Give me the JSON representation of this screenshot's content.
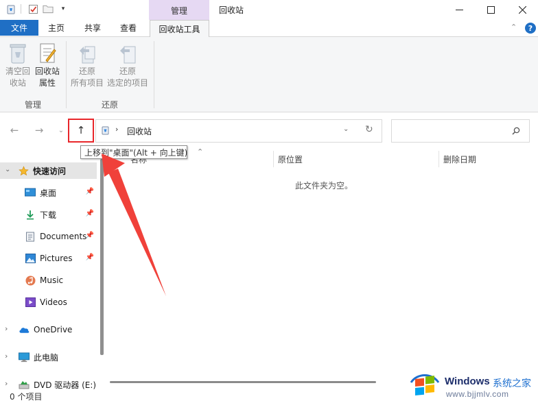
{
  "titlebar": {
    "context_tab": "管理",
    "window_title": "回收站",
    "quick_access_icons": [
      "recycle-bin-icon",
      "properties-check-icon",
      "folder-icon",
      "dropdown-arrow-icon"
    ],
    "window_controls": [
      "minimize-icon",
      "maximize-icon",
      "close-icon"
    ]
  },
  "ribbon_tabs": {
    "file": "文件",
    "home": "主页",
    "share": "共享",
    "view": "查看",
    "recycle_tools": "回收站工具"
  },
  "ribbon": {
    "groups": {
      "manage": "管理",
      "restore": "还原"
    },
    "buttons": {
      "empty_line1": "清空回",
      "empty_line2": "收站",
      "props_line1": "回收站",
      "props_line2": "属性",
      "restore_all_line1": "还原",
      "restore_all_line2": "所有项目",
      "restore_sel_line1": "还原",
      "restore_sel_line2": "选定的项目"
    }
  },
  "address_bar": {
    "path": "回收站",
    "search_placeholder": ""
  },
  "tooltip": "上移到\"桌面\"(Alt + 向上键)",
  "nav": {
    "quick_access": "快速访问",
    "items": [
      {
        "label": "桌面",
        "icon": "desktop-icon",
        "pinned": true
      },
      {
        "label": "下载",
        "icon": "download-icon",
        "pinned": true
      },
      {
        "label": "Documents",
        "icon": "documents-icon",
        "pinned": true
      },
      {
        "label": "Pictures",
        "icon": "pictures-icon",
        "pinned": true
      },
      {
        "label": "Music",
        "icon": "music-icon",
        "pinned": false
      },
      {
        "label": "Videos",
        "icon": "videos-icon",
        "pinned": false
      }
    ],
    "onedrive": "OneDrive",
    "this_pc": "此电脑",
    "dvd": "DVD 驱动器 (E:)"
  },
  "columns": {
    "name": "名称",
    "original_location": "原位置",
    "date_deleted": "删除日期"
  },
  "empty_message": "此文件夹为空。",
  "status": "0 个项目",
  "watermark": {
    "brand": "Windows",
    "brand_cn": "系统之家",
    "url": "www.bjjmlv.com"
  },
  "colors": {
    "accent": "#1f6fc5",
    "context_tab": "#e6d9f3",
    "highlight": "#e8262a"
  }
}
